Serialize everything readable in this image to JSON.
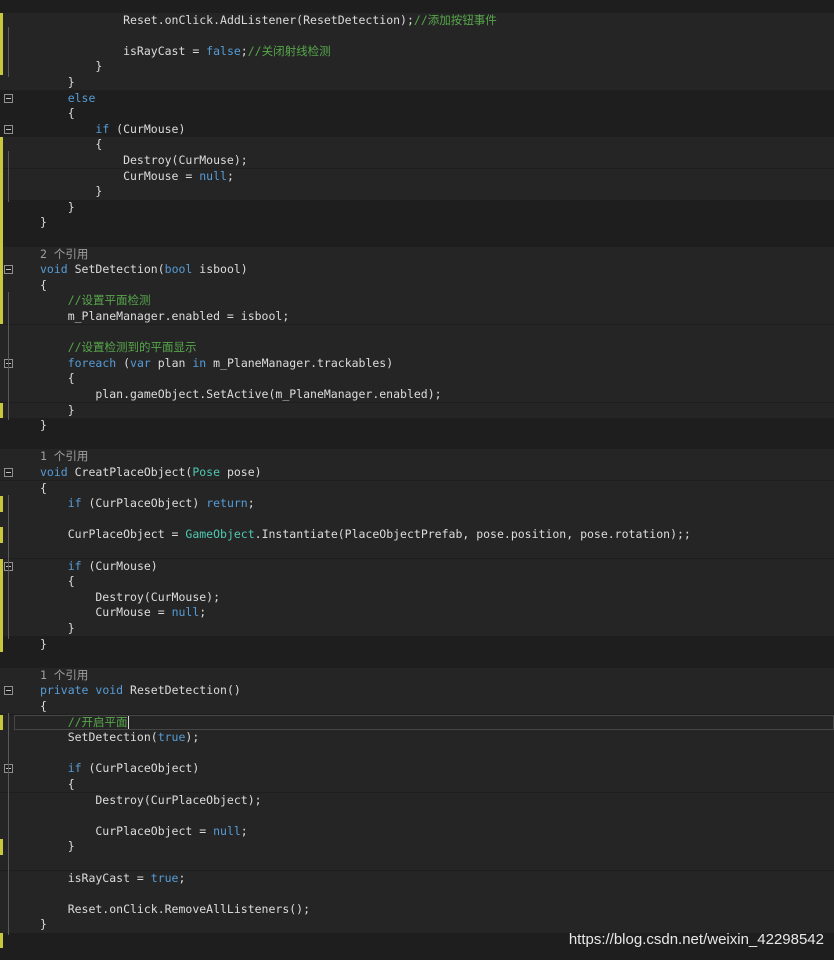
{
  "editor": {
    "lines": [
      {
        "n": 1,
        "p": [
          [
            "            ",
            ""
          ],
          [
            "Reset.onClick.AddListener(ResetDetection);",
            ""
          ],
          [
            "//添加按钮事件",
            "cm"
          ]
        ]
      },
      {
        "n": 2,
        "p": []
      },
      {
        "n": 3,
        "p": [
          [
            "            isRayCast = ",
            ""
          ],
          [
            "false",
            "kw"
          ],
          [
            ";",
            ""
          ],
          [
            "//关闭射线检测",
            "cm"
          ]
        ]
      },
      {
        "n": 4,
        "p": [
          [
            "        }",
            ""
          ]
        ]
      },
      {
        "n": 5,
        "p": [
          [
            "    }",
            ""
          ]
        ]
      },
      {
        "n": 6,
        "p": [
          [
            "    ",
            ""
          ],
          [
            "else",
            "kw"
          ]
        ]
      },
      {
        "n": 7,
        "p": [
          [
            "    {",
            ""
          ]
        ]
      },
      {
        "n": 8,
        "p": [
          [
            "        ",
            ""
          ],
          [
            "if",
            "kw"
          ],
          [
            " (CurMouse)",
            ""
          ]
        ]
      },
      {
        "n": 9,
        "p": [
          [
            "        {",
            ""
          ]
        ]
      },
      {
        "n": 10,
        "p": [
          [
            "            Destroy(CurMouse);",
            ""
          ]
        ]
      },
      {
        "n": 11,
        "p": [
          [
            "            CurMouse = ",
            ""
          ],
          [
            "null",
            "kw"
          ],
          [
            ";",
            ""
          ]
        ]
      },
      {
        "n": 12,
        "p": [
          [
            "        }",
            ""
          ]
        ]
      },
      {
        "n": 13,
        "p": [
          [
            "    }",
            ""
          ]
        ]
      },
      {
        "n": 14,
        "p": [
          [
            "}",
            ""
          ]
        ]
      },
      {
        "n": 15,
        "p": []
      },
      {
        "n": 16,
        "p": [
          [
            "2 个引用",
            "ref"
          ]
        ]
      },
      {
        "n": 17,
        "p": [
          [
            "void",
            "kw"
          ],
          [
            " SetDetection(",
            ""
          ],
          [
            "bool",
            "kw"
          ],
          [
            " isbool)",
            ""
          ]
        ]
      },
      {
        "n": 18,
        "p": [
          [
            "{",
            ""
          ]
        ]
      },
      {
        "n": 19,
        "p": [
          [
            "    ",
            ""
          ],
          [
            "//设置平面检测",
            "cm"
          ]
        ]
      },
      {
        "n": 20,
        "p": [
          [
            "    m_PlaneManager.enabled = isbool;",
            ""
          ]
        ]
      },
      {
        "n": 21,
        "p": []
      },
      {
        "n": 22,
        "p": [
          [
            "    ",
            ""
          ],
          [
            "//设置检测到的平面显示",
            "cm"
          ]
        ]
      },
      {
        "n": 23,
        "p": [
          [
            "    ",
            ""
          ],
          [
            "foreach",
            "kw"
          ],
          [
            " (",
            ""
          ],
          [
            "var",
            "kw"
          ],
          [
            " plan ",
            ""
          ],
          [
            "in",
            "kw"
          ],
          [
            " m_PlaneManager.trackables)",
            ""
          ]
        ]
      },
      {
        "n": 24,
        "p": [
          [
            "    {",
            ""
          ]
        ]
      },
      {
        "n": 25,
        "p": [
          [
            "        plan.gameObject.SetActive(m_PlaneManager.enabled);",
            ""
          ]
        ]
      },
      {
        "n": 26,
        "p": [
          [
            "    }",
            ""
          ]
        ]
      },
      {
        "n": 27,
        "p": [
          [
            "}",
            ""
          ]
        ]
      },
      {
        "n": 28,
        "p": []
      },
      {
        "n": 29,
        "p": [
          [
            "1 个引用",
            "ref"
          ]
        ]
      },
      {
        "n": 30,
        "p": [
          [
            "void",
            "kw"
          ],
          [
            " CreatPlaceObject(",
            ""
          ],
          [
            "Pose",
            "ty"
          ],
          [
            " pose)",
            ""
          ]
        ]
      },
      {
        "n": 31,
        "p": [
          [
            "{",
            ""
          ]
        ]
      },
      {
        "n": 32,
        "p": [
          [
            "    ",
            ""
          ],
          [
            "if",
            "kw"
          ],
          [
            " (CurPlaceObject) ",
            ""
          ],
          [
            "return",
            "kw"
          ],
          [
            ";",
            ""
          ]
        ]
      },
      {
        "n": 33,
        "p": []
      },
      {
        "n": 34,
        "p": [
          [
            "    CurPlaceObject = ",
            ""
          ],
          [
            "GameObject",
            "ty"
          ],
          [
            ".Instantiate(PlaceObjectPrefab, pose.position, pose.rotation);;",
            ""
          ]
        ]
      },
      {
        "n": 35,
        "p": []
      },
      {
        "n": 36,
        "p": [
          [
            "    ",
            ""
          ],
          [
            "if",
            "kw"
          ],
          [
            " (CurMouse)",
            ""
          ]
        ]
      },
      {
        "n": 37,
        "p": [
          [
            "    {",
            ""
          ]
        ]
      },
      {
        "n": 38,
        "p": [
          [
            "        Destroy(CurMouse);",
            ""
          ]
        ]
      },
      {
        "n": 39,
        "p": [
          [
            "        CurMouse = ",
            ""
          ],
          [
            "null",
            "kw"
          ],
          [
            ";",
            ""
          ]
        ]
      },
      {
        "n": 40,
        "p": [
          [
            "    }",
            ""
          ]
        ]
      },
      {
        "n": 41,
        "p": [
          [
            "}",
            ""
          ]
        ]
      },
      {
        "n": 42,
        "p": []
      },
      {
        "n": 43,
        "p": [
          [
            "1 个引用",
            "ref"
          ]
        ]
      },
      {
        "n": 44,
        "p": [
          [
            "private",
            "kw"
          ],
          [
            " ",
            ""
          ],
          [
            "void",
            "kw"
          ],
          [
            " ResetDetection()",
            ""
          ]
        ]
      },
      {
        "n": 45,
        "p": [
          [
            "{",
            ""
          ]
        ]
      },
      {
        "n": 46,
        "p": [
          [
            "    ",
            ""
          ],
          [
            "//开启平面",
            "cm"
          ]
        ]
      },
      {
        "n": 47,
        "p": [
          [
            "    SetDetection(",
            ""
          ],
          [
            "true",
            "kw"
          ],
          [
            ");",
            ""
          ]
        ]
      },
      {
        "n": 48,
        "p": []
      },
      {
        "n": 49,
        "p": [
          [
            "    ",
            ""
          ],
          [
            "if",
            "kw"
          ],
          [
            " (CurPlaceObject)",
            ""
          ]
        ]
      },
      {
        "n": 50,
        "p": [
          [
            "    {",
            ""
          ]
        ]
      },
      {
        "n": 51,
        "p": [
          [
            "        Destroy(CurPlaceObject);",
            ""
          ]
        ]
      },
      {
        "n": 52,
        "p": []
      },
      {
        "n": 53,
        "p": [
          [
            "        CurPlaceObject = ",
            ""
          ],
          [
            "null",
            "kw"
          ],
          [
            ";",
            ""
          ]
        ]
      },
      {
        "n": 54,
        "p": [
          [
            "    }",
            ""
          ]
        ]
      },
      {
        "n": 55,
        "p": []
      },
      {
        "n": 56,
        "p": [
          [
            "    isRayCast = ",
            ""
          ],
          [
            "true",
            "kw"
          ],
          [
            ";",
            ""
          ]
        ]
      },
      {
        "n": 57,
        "p": []
      },
      {
        "n": 58,
        "p": [
          [
            "    Reset.onClick.RemoveAllListeners();",
            ""
          ]
        ]
      },
      {
        "n": 59,
        "p": [
          [
            "}",
            ""
          ]
        ]
      },
      {
        "n": 60,
        "p": []
      }
    ]
  },
  "watermark": "https://blog.csdn.net/weixin_42298542",
  "colors": {
    "background": "#1e1e1e",
    "keyword": "#569cd6",
    "comment": "#57a64a",
    "type": "#4ec9b0",
    "text": "#dcdcdc"
  }
}
